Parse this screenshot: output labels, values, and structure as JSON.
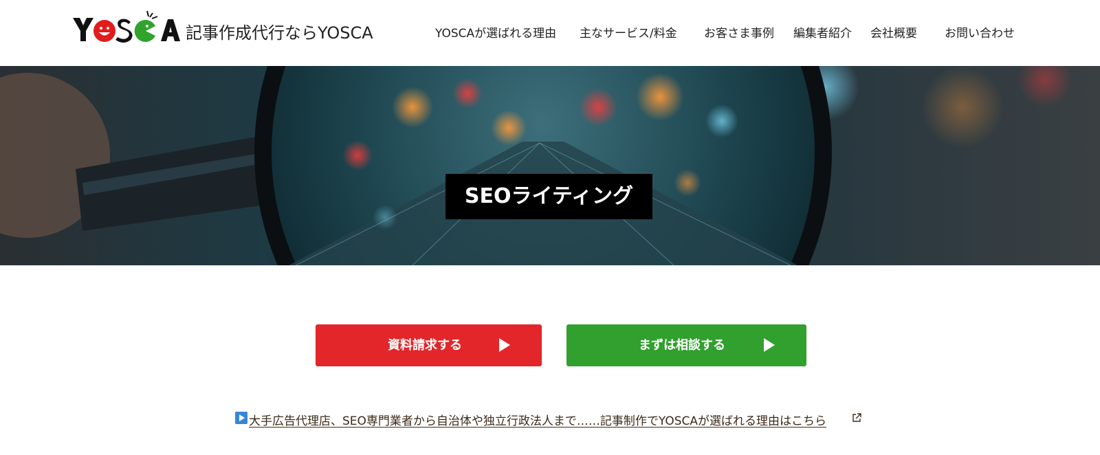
{
  "header": {
    "logo_text": "記事作成代行ならYOSCA",
    "nav": [
      {
        "label": "YOSCAが選ばれる理由"
      },
      {
        "label": "主なサービス/料金"
      },
      {
        "label": "お客さま事例"
      },
      {
        "label": "編集者紹介"
      },
      {
        "label": "会社概要"
      },
      {
        "label": "お問い合わせ"
      }
    ]
  },
  "hero": {
    "title": "SEOライティング"
  },
  "cta": {
    "request_label": "資料請求する",
    "consult_label": "まずは相談する",
    "arrow_icon": "play-triangle-icon"
  },
  "promo": {
    "icon": "play-box-icon",
    "link_text": "大手広告代理店、SEO専門業者から自治体や独立行政法人まで……記事制作でYOSCAが選ばれる理由はこちら",
    "external_icon": "external-link-icon"
  },
  "colors": {
    "red": "#e2262a",
    "green": "#31a02e",
    "blue_icon": "#3a86d6",
    "link": "#3b2a1a"
  }
}
